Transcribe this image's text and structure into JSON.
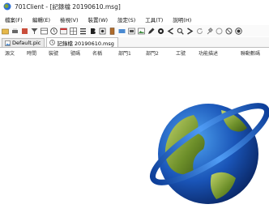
{
  "window": {
    "title": "701Client - [記錄檔 20190610.msg]"
  },
  "menu": [
    "檔案(F)",
    "編輯(E)",
    "檢視(V)",
    "裝置(W)",
    "設定(S)",
    "工具(T)",
    "說明(H)"
  ],
  "toolbar": {
    "icons": [
      "open-icon",
      "print-icon",
      "export-icon",
      "filter-icon",
      "table-icon",
      "clock-icon",
      "calendar-icon",
      "grid-icon",
      "list-icon",
      "bold-icon",
      "capture-icon",
      "door-icon",
      "card-icon",
      "panel-icon",
      "image-icon",
      "pen-icon",
      "gear-icon",
      "back-icon",
      "search-icon",
      "forward-icon",
      "refresh-icon",
      "pin-icon",
      "star-icon",
      "stop-icon",
      "record-icon"
    ]
  },
  "tabs": [
    {
      "label": "Default.pic",
      "active": false,
      "icon": "picture-icon"
    },
    {
      "label": "記錄檔 20190610.msg",
      "active": true,
      "icon": "log-icon"
    }
  ],
  "grid": {
    "columns": [
      "源文",
      "時間",
      "裝號",
      "號碼",
      "名稱",
      "部門1",
      "部門2",
      "工號",
      "功能描述",
      "聯動數碼"
    ]
  },
  "colors": {
    "accent": "#2b6fd6",
    "globe_green": "#6d8f2a",
    "globe_blue": "#1f63c7"
  }
}
